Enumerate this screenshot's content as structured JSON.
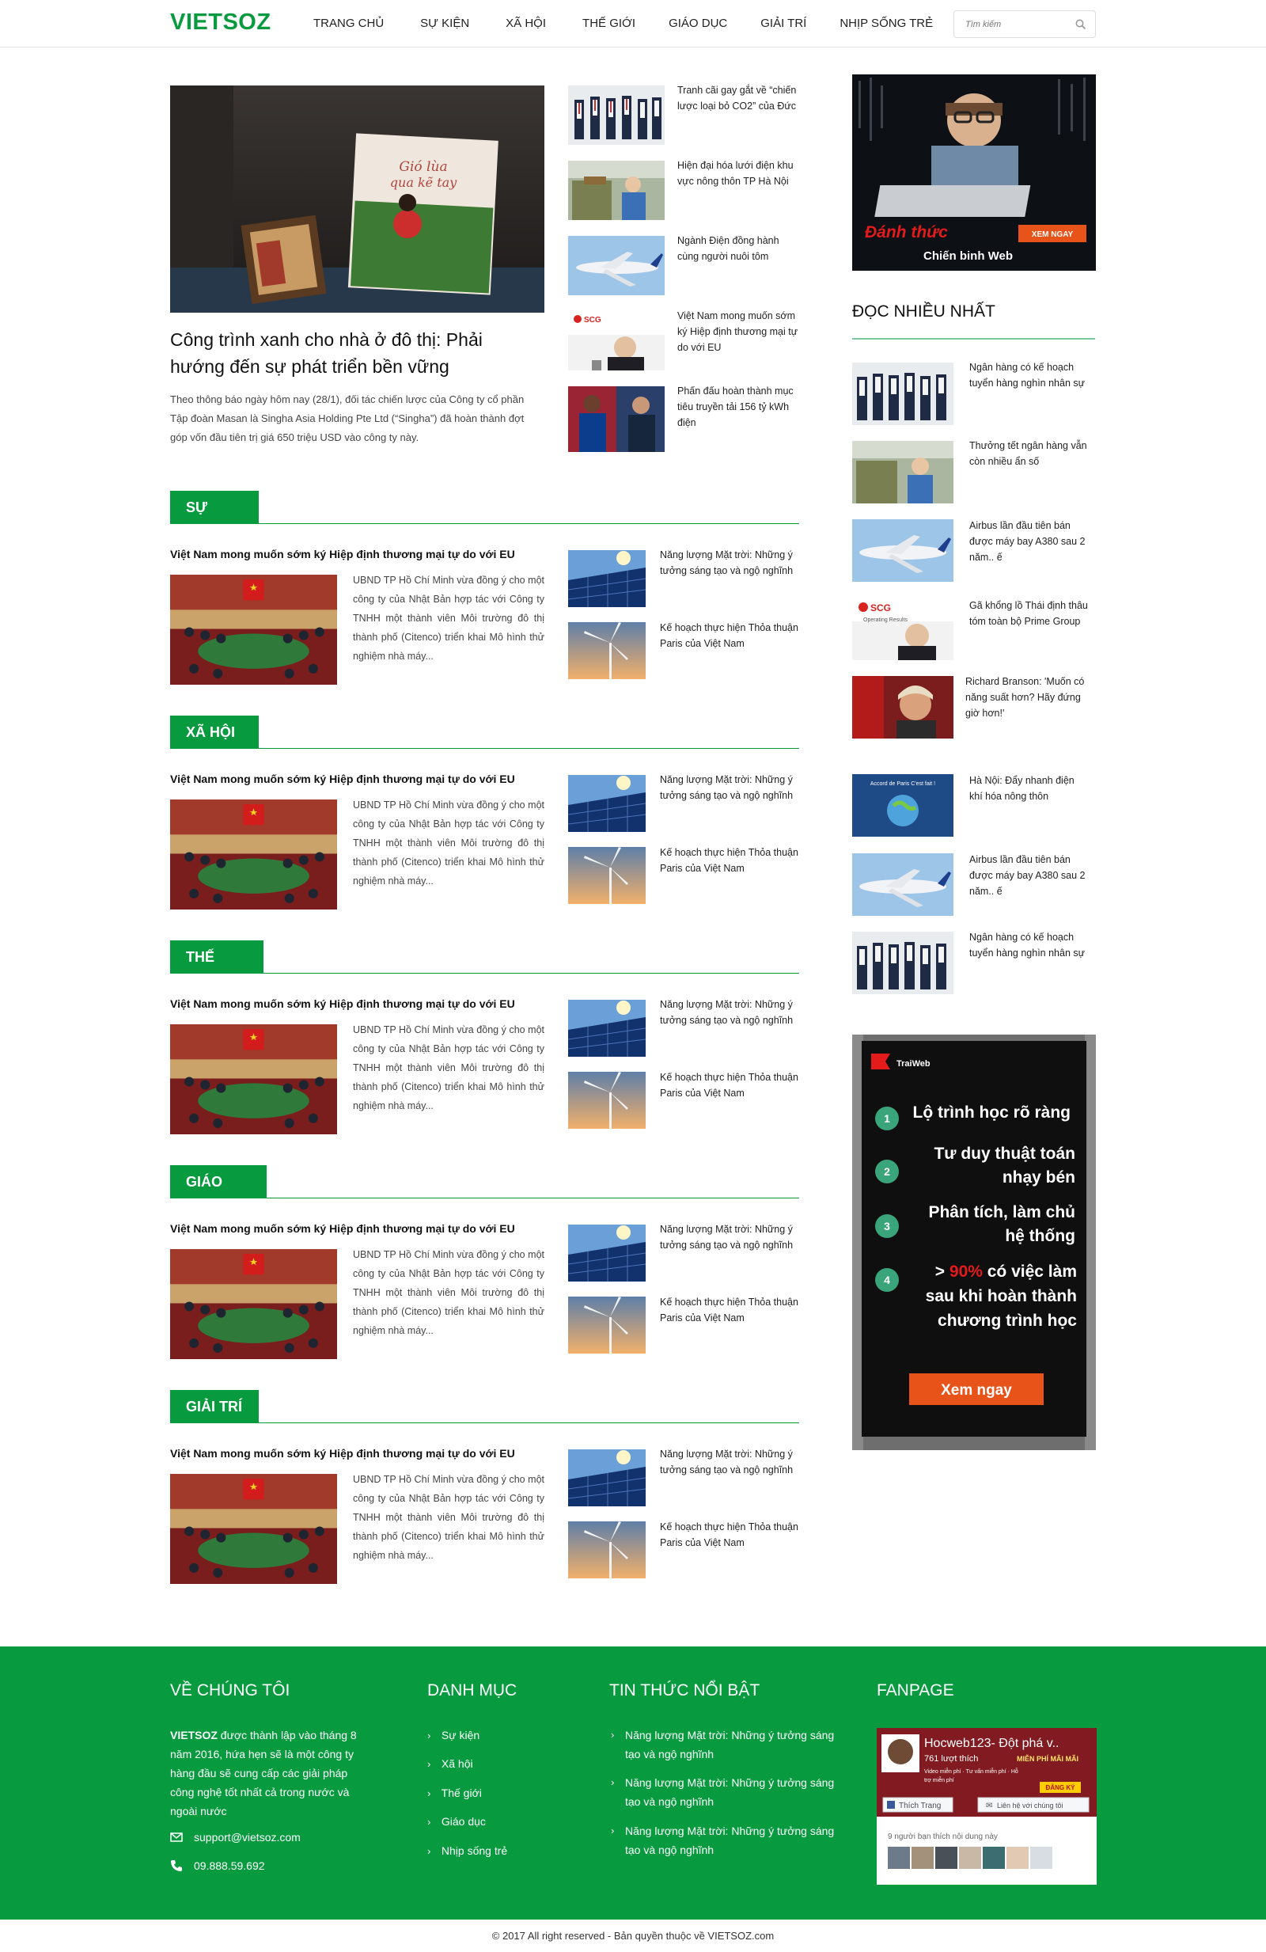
{
  "header": {
    "logo": "VIETSOZ",
    "nav": [
      "TRANG CHỦ",
      "SỰ KIỆN",
      "XÃ HỘI",
      "THẾ GIỚI",
      "GIÁO DỤC",
      "GIẢI TRÍ",
      "NHỊP SỐNG TRẺ"
    ],
    "search_placeholder": "Tìm kiếm"
  },
  "featured": {
    "book_title_line1": "Gió lùa",
    "book_title_line2": "qua kẽ tay",
    "title": "Công trình xanh cho nhà ở đô thị: Phải hướng đến sự phát triển bền vững",
    "excerpt": "Theo thông báo ngày hôm nay (28/1), đối tác chiến lược của Công ty cổ phần Tập đoàn Masan là Singha Asia Holding Pte Ltd (“Singha”) đã hoàn thành đợt góp vốn đầu tiên trị giá 650 triệu USD vào công ty này."
  },
  "top_list": [
    "Tranh cãi gay gắt về “chiến lược loại bỏ CO2” của Đức",
    "Hiện đại hóa lưới điện khu vực nông thôn TP Hà Nội",
    "Ngành Điện đồng hành cùng người nuôi tôm",
    "Việt Nam mong muốn sớm ký Hiệp định thương mại tự do với EU",
    "Phấn đấu hoàn thành mục tiêu truyền tải 156 tỷ kWh điện"
  ],
  "categories": [
    {
      "label": "SỰ KIỆN"
    },
    {
      "label": "XÃ HỘI"
    },
    {
      "label": "THẾ GIỚI"
    },
    {
      "label": "GIÁO DỤC"
    },
    {
      "label": "GIẢI TRÍ"
    }
  ],
  "category_article": {
    "title": "Việt Nam mong muốn sớm ký Hiệp định thương mại tự do với EU",
    "excerpt": "UBND TP Hồ Chí Minh vừa đồng ý cho một công ty của Nhật Bản hợp tác với Công ty TNHH một thành viên Môi trường đô thị thành phố (Citenco) triển khai Mô hình thử nghiệm nhà máy...",
    "side": [
      "Năng lượng Mặt trời: Những ý tưởng sáng tạo và ngộ nghĩnh",
      "Kế hoạch thực hiện Thỏa thuận Paris của Việt Nam"
    ]
  },
  "ad_top": {
    "line1": "Đánh thức",
    "line2": "Chiến binh Web",
    "cta": "XEM NGAY"
  },
  "popular": {
    "heading": "ĐỌC NHIỀU NHẤT",
    "items": [
      "Ngân hàng có kế hoạch tuyển hàng nghìn nhân sự",
      "Thưởng tết ngân hàng vẫn còn nhiều ẩn số",
      "Airbus lần đầu tiên bán được máy bay A380 sau 2 năm.. ế",
      "Gã khổng lồ Thái định thâu tóm toàn bộ Prime Group",
      "Richard Branson: 'Muốn có năng suất hơn? Hãy đứng giờ hơn!'",
      "Hà Nội: Đẩy nhanh điện khí hóa nông thôn",
      "Airbus lần đầu tiên bán được máy bay A380 sau 2 năm.. ế",
      "Ngân hàng có kế hoạch tuyển hàng nghìn nhân sự"
    ],
    "scg_label": "SCG",
    "scg_sub": "Operating Results",
    "earth_label": "Accord de Paris C'est fait !"
  },
  "ad_bottom": {
    "brand": "TraiWeb",
    "steps": [
      {
        "num": "1",
        "text": "Lộ trình học rõ ràng"
      },
      {
        "num": "2",
        "text": "Tư duy thuật toán nhạy bén"
      },
      {
        "num": "3",
        "text": "Phân tích, làm chủ hệ thống"
      },
      {
        "num": "4",
        "pre": "> ",
        "highlight": "90%",
        "text": " có việc làm sau khi hoàn thành chương trình học"
      }
    ],
    "cta": "Xem ngay"
  },
  "footer": {
    "about_heading": "VỀ CHÚNG TÔI",
    "about_brand": "VIETSOZ",
    "about_text": " được thành lập vào tháng 8 năm 2016, hứa hẹn sẽ là một công ty hàng đầu sẽ cung cấp các giải pháp công nghệ tốt nhất cả trong nước và ngoài nước",
    "email": "support@vietsoz.com",
    "phone": "09.888.59.692",
    "category_heading": "DANH MỤC",
    "categories": [
      "Sự kiện",
      "Xã hội",
      "Thế giới",
      "Giáo dục",
      "Nhịp sống trẻ"
    ],
    "news_heading": "TIN THỨC NỔI BẬT",
    "news": [
      "Năng lượng Mặt trời: Những ý tưởng sáng tạo và ngộ nghĩnh",
      "Năng lượng Mặt trời: Những ý tưởng sáng tạo và ngộ nghĩnh",
      "Năng lượng Mặt trời: Những ý tưởng sáng tạo và ngộ nghĩnh"
    ],
    "fanpage_heading": "FANPAGE",
    "fanpage": {
      "name": "Hocweb123- Đột phá v..",
      "likes": "761 lượt thích",
      "banner_text": "MIỄN PHÍ MÃI MÃI",
      "banner_sub": "Video miễn phí · Tư vấn miễn phí · Hỗ trợ miễn phí",
      "register": "ĐĂNG KÝ",
      "like_button": "Thích Trang",
      "contact_button": "Liên hệ với chúng tôi",
      "friends_text": "9 người bạn thích nội dung này"
    }
  },
  "copyright": "© 2017 All right reserved - Bản quyền thuộc về VIETSOZ.com",
  "colors": {
    "brand_green": "#079a3f",
    "ad_orange": "#e8531a",
    "ad_red": "#e31b1b"
  }
}
